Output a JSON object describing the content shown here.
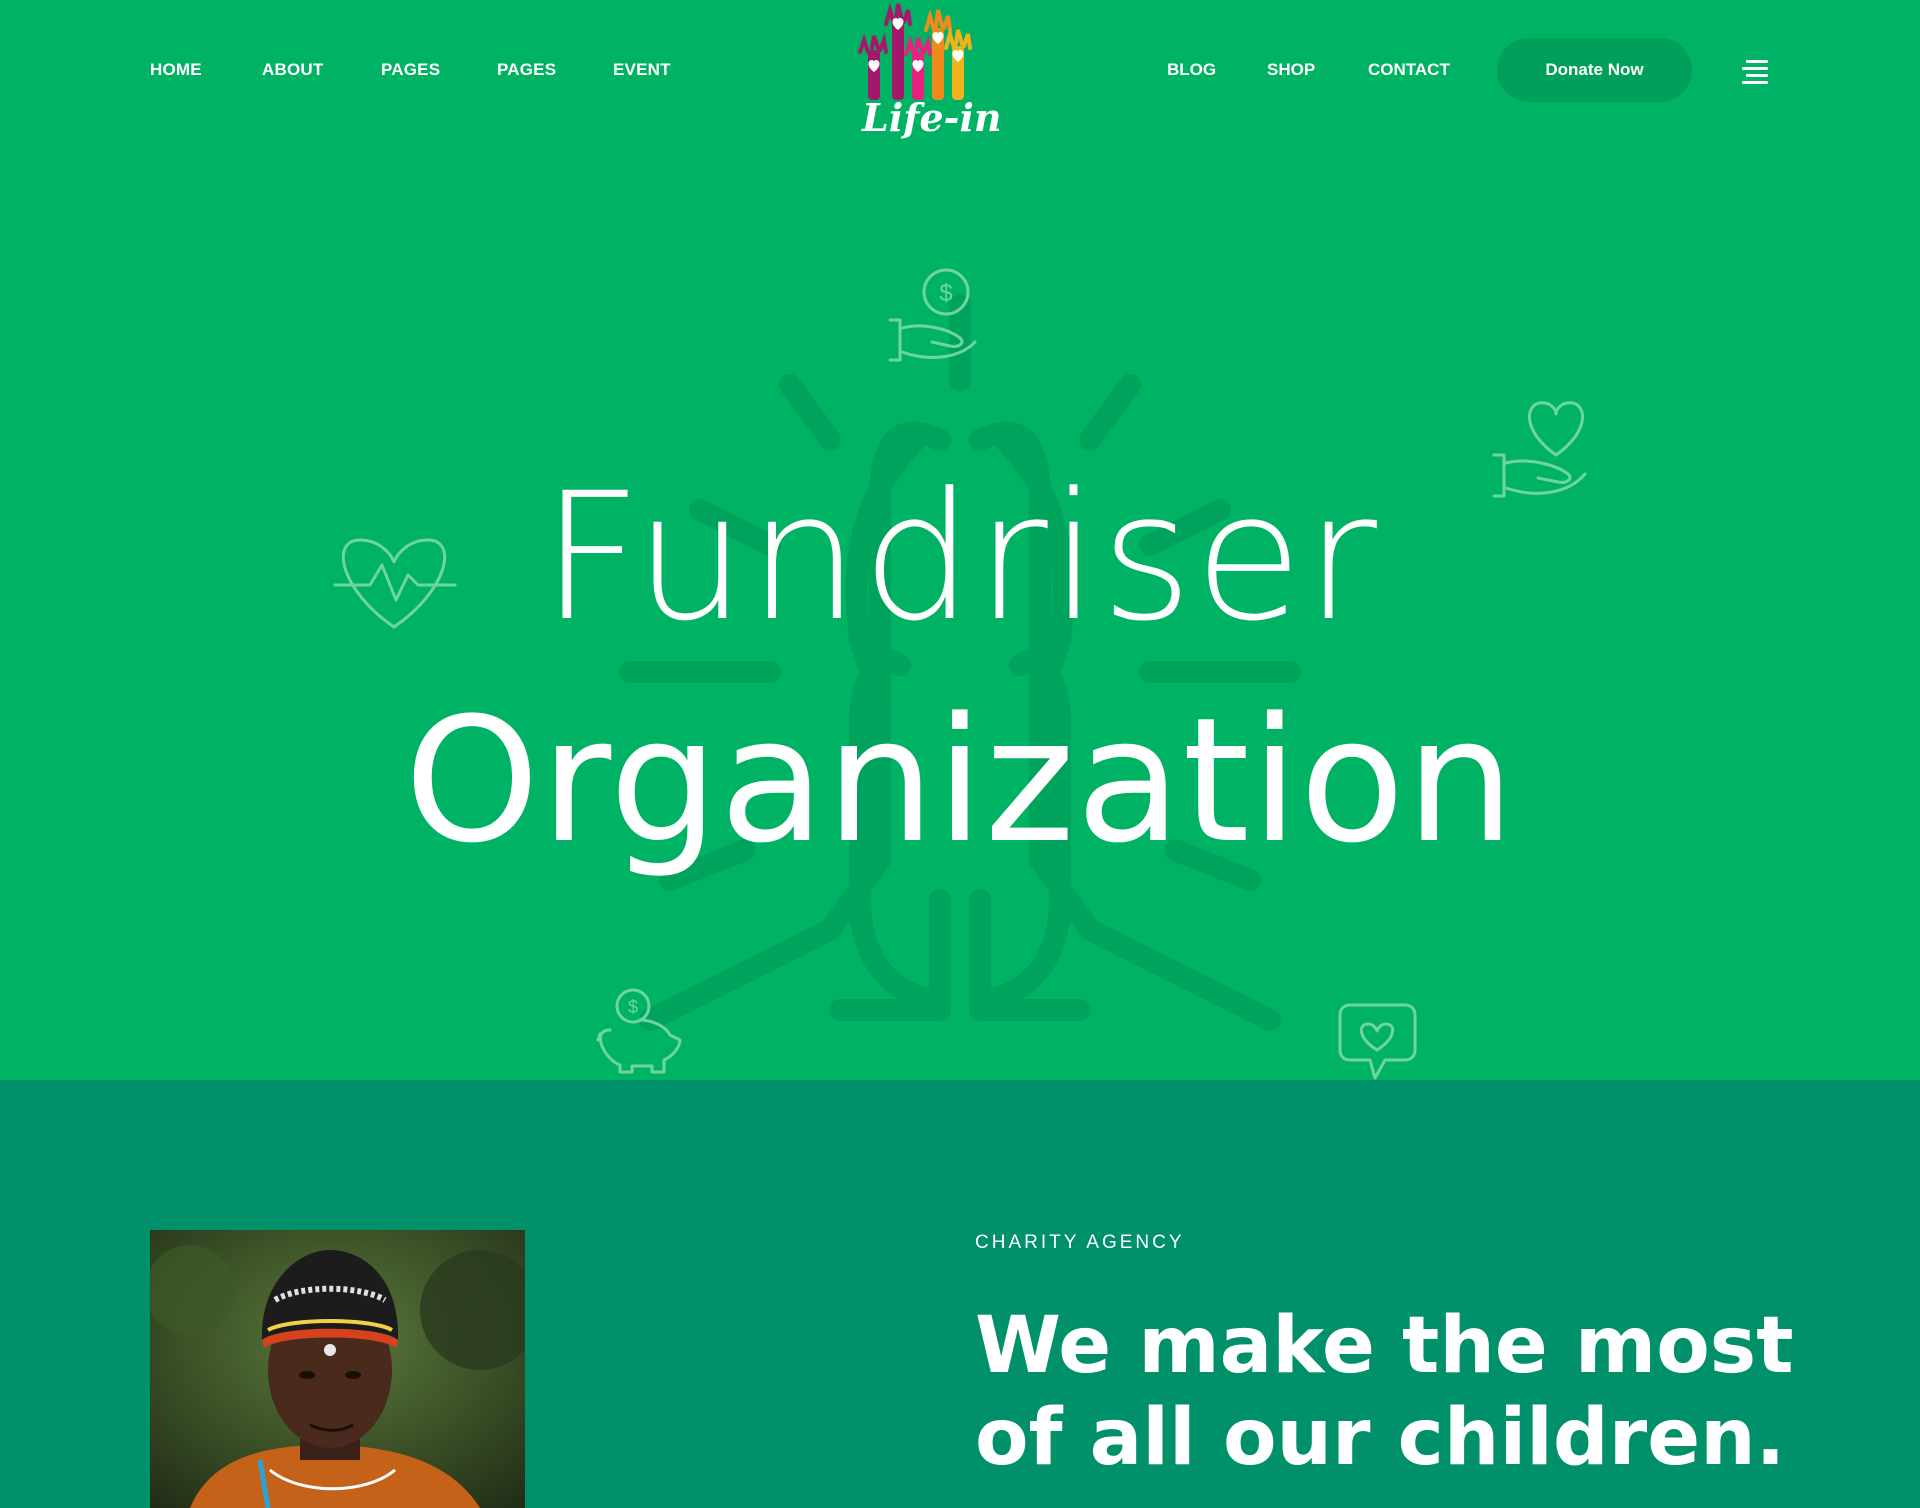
{
  "nav": {
    "left_items": [
      {
        "label": "HOME"
      },
      {
        "label": "ABOUT"
      },
      {
        "label": "PAGES"
      },
      {
        "label": "PAGES"
      },
      {
        "label": "EVENT"
      }
    ],
    "right_items": [
      {
        "label": "BLOG"
      },
      {
        "label": "SHOP"
      },
      {
        "label": "CONTACT"
      }
    ],
    "donate_label": "Donate Now",
    "menu_icon": "hamburger-menu-icon"
  },
  "logo": {
    "text": "Life-in",
    "colors": [
      "#a3186a",
      "#e8217f",
      "#f08a1c",
      "#f2b21b"
    ]
  },
  "hero": {
    "line1": "Fundriser",
    "line2": "Organization",
    "background_color": "#00b364",
    "icons": [
      "hand-coin-icon",
      "hand-heart-icon",
      "heartbeat-icon",
      "piggy-bank-icon",
      "heart-chat-icon",
      "praying-hands-icon"
    ]
  },
  "about": {
    "eyebrow": "CHARITY AGENCY",
    "headline_line1": "We make the most",
    "headline_line2": "of all our children.",
    "background_color": "#00916b"
  }
}
